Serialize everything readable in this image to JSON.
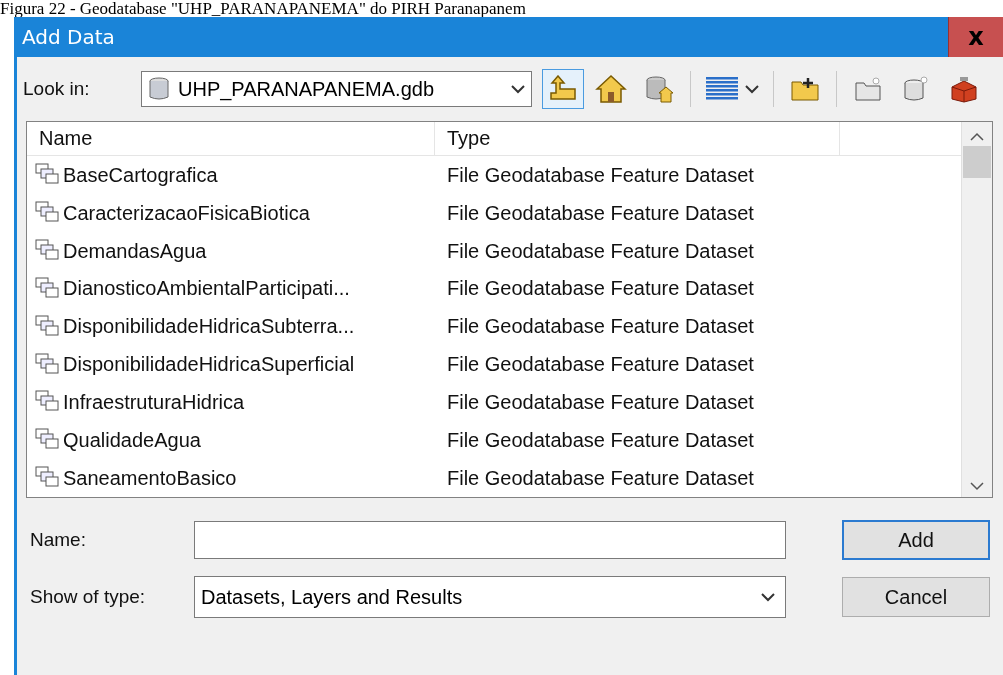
{
  "caption": "Figura 22 - Geodatabase \"UHP_PARANAPANEMA\" do PIRH Paranapanem",
  "window": {
    "title": "Add Data",
    "close_glyph": "x"
  },
  "look_in": {
    "label": "Look in:",
    "value": "UHP_PARANAPANEMA.gdb"
  },
  "toolbar": [
    {
      "kind": "up",
      "selected": true
    },
    {
      "kind": "home",
      "selected": false
    },
    {
      "kind": "dbhome",
      "selected": false
    },
    {
      "kind": "sep"
    },
    {
      "kind": "view",
      "selected": false
    },
    {
      "kind": "sep"
    },
    {
      "kind": "newfolder",
      "selected": false
    },
    {
      "kind": "sep"
    },
    {
      "kind": "folder",
      "selected": false
    },
    {
      "kind": "newdb",
      "selected": false
    },
    {
      "kind": "toolbox",
      "selected": false
    }
  ],
  "table": {
    "columns": [
      "Name",
      "Type"
    ],
    "rows": [
      {
        "name": "BaseCartografica",
        "type": "File Geodatabase Feature Dataset"
      },
      {
        "name": "CaracterizacaoFisicaBiotica",
        "type": "File Geodatabase Feature Dataset"
      },
      {
        "name": "DemandasAgua",
        "type": "File Geodatabase Feature Dataset"
      },
      {
        "name": "DianosticoAmbientalParticipati...",
        "type": "File Geodatabase Feature Dataset"
      },
      {
        "name": "DisponibilidadeHidricaSubterra...",
        "type": "File Geodatabase Feature Dataset"
      },
      {
        "name": "DisponibilidadeHidricaSuperficial",
        "type": "File Geodatabase Feature Dataset"
      },
      {
        "name": "InfraestruturaHidrica",
        "type": "File Geodatabase Feature Dataset"
      },
      {
        "name": "QualidadeAgua",
        "type": "File Geodatabase Feature Dataset"
      },
      {
        "name": "SaneamentoBasico",
        "type": "File Geodatabase Feature Dataset"
      }
    ]
  },
  "name_field": {
    "label": "Name:"
  },
  "type_field": {
    "label": "Show of type:",
    "value": "Datasets, Layers and Results"
  },
  "buttons": [
    {
      "label": "Add",
      "default": true
    },
    {
      "label": "Cancel",
      "default": false
    }
  ]
}
